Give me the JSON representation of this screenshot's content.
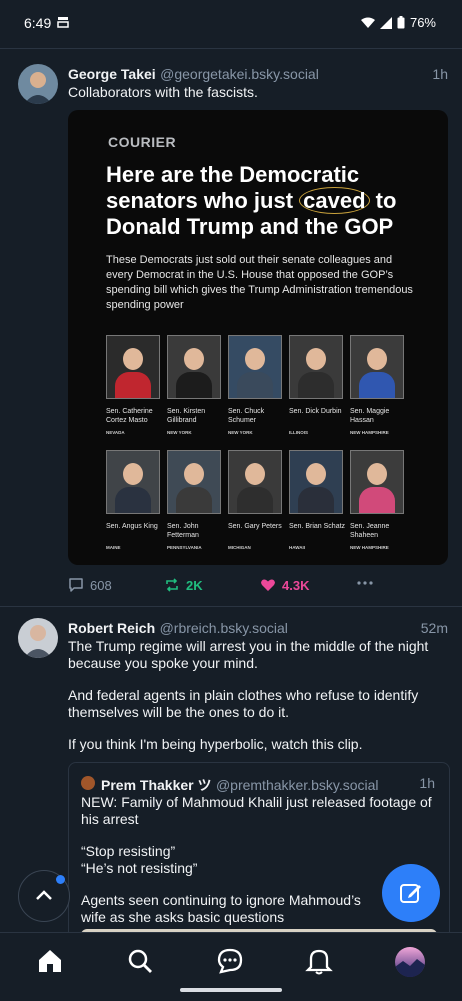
{
  "status": {
    "time": "6:49",
    "battery": "76%"
  },
  "post1": {
    "author": "George Takei",
    "handle": "@georgetakei.bsky.social",
    "time": "1h",
    "text": "Collaborators with the fascists.",
    "embed": {
      "brand": "COURIER",
      "headline_a": "Here are the Democratic senators who just ",
      "headline_highlight": "caved",
      "headline_b": " to Donald Trump and the GOP",
      "subhead": "These Democrats just sold out their senate colleagues and every Democrat in the U.S. House that opposed the GOP’s spending bill which gives the Trump Administration tremendous spending power",
      "senators": [
        {
          "name": "Sen. Catherine Cortez Masto",
          "state": "NEVADA"
        },
        {
          "name": "Sen. Kirsten Gillibrand",
          "state": "NEW YORK"
        },
        {
          "name": "Sen. Chuck Schumer",
          "state": "NEW YORK"
        },
        {
          "name": "Sen. Dick Durbin",
          "state": "ILLINOIS"
        },
        {
          "name": "Sen. Maggie Hassan",
          "state": "NEW HAMPSHIRE"
        },
        {
          "name": "Sen. Angus King",
          "state": "MAINE"
        },
        {
          "name": "Sen. John Fetterman",
          "state": "PENNSYLVANIA"
        },
        {
          "name": "Sen. Gary Peters",
          "state": "MICHIGAN"
        },
        {
          "name": "Sen. Brian Schatz",
          "state": "HAWAII"
        },
        {
          "name": "Sen. Jeanne Shaheen",
          "state": "NEW HAMPSHIRE"
        }
      ]
    },
    "replies": "608",
    "reposts": "2K",
    "likes": "4.3K"
  },
  "post2": {
    "author": "Robert Reich",
    "handle": "@rbreich.bsky.social",
    "time": "52m",
    "p1": "The Trump regime will arrest you in the middle of the night because you spoke your mind.",
    "p2": "And federal agents in plain clothes who refuse to identify themselves will be the ones to do it.",
    "p3": "If you think I'm being hyperbolic, watch this clip.",
    "quote": {
      "author": "Prem Thakker ツ",
      "handle": "@premthakker.bsky.social",
      "time": "1h",
      "p1": "NEW: Family of Mahmoud Khalil just released footage of his arrest",
      "p2a": "“Stop resisting”",
      "p2b": "“He’s not resisting”",
      "p3": "Agents seen continuing to ignore Mahmoud’s wife as she asks basic questions"
    }
  },
  "colors": {
    "accent": "#2d7ff9",
    "repost": "#20bc7e",
    "like": "#ec4899",
    "bg": "#161e27"
  },
  "icons": [
    "home-icon",
    "search-icon",
    "chat-icon",
    "bell-icon",
    "compose-icon",
    "chevron-up-icon"
  ]
}
